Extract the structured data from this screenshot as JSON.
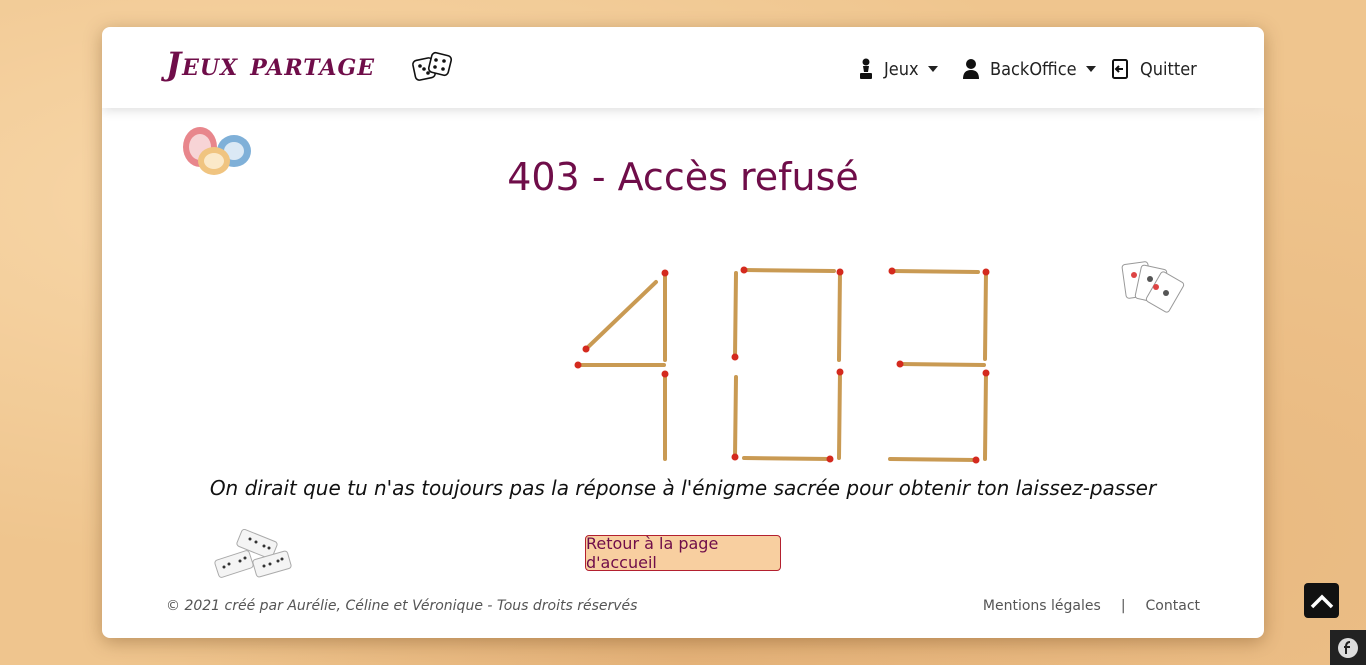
{
  "navbar": {
    "brand": "Jeux partage",
    "items": [
      {
        "label": "Jeux",
        "icon": "chess-pawn-icon",
        "dropdown": true
      },
      {
        "label": "BackOffice",
        "icon": "user-icon",
        "dropdown": true
      },
      {
        "label": "Quitter",
        "icon": "logout-icon",
        "dropdown": false
      }
    ]
  },
  "main": {
    "title": "403 - Accès refusé",
    "message": "On dirait que tu n'as toujours pas la réponse à l'énigme sacrée pour obtenir ton laissez-passer",
    "button_label": "Retour à la page d'accueil"
  },
  "footer": {
    "copyright": "© 2021 créé par Aurélie, Céline et Véronique - Tous droits réservés",
    "separator": "|",
    "links": [
      "Mentions légales",
      "Contact"
    ]
  },
  "colors": {
    "brand": "#6f0d49",
    "button_bg": "#f8cfa0",
    "button_border": "#b3202f",
    "match_stick": "#c99a53",
    "match_head": "#d42a1e"
  }
}
